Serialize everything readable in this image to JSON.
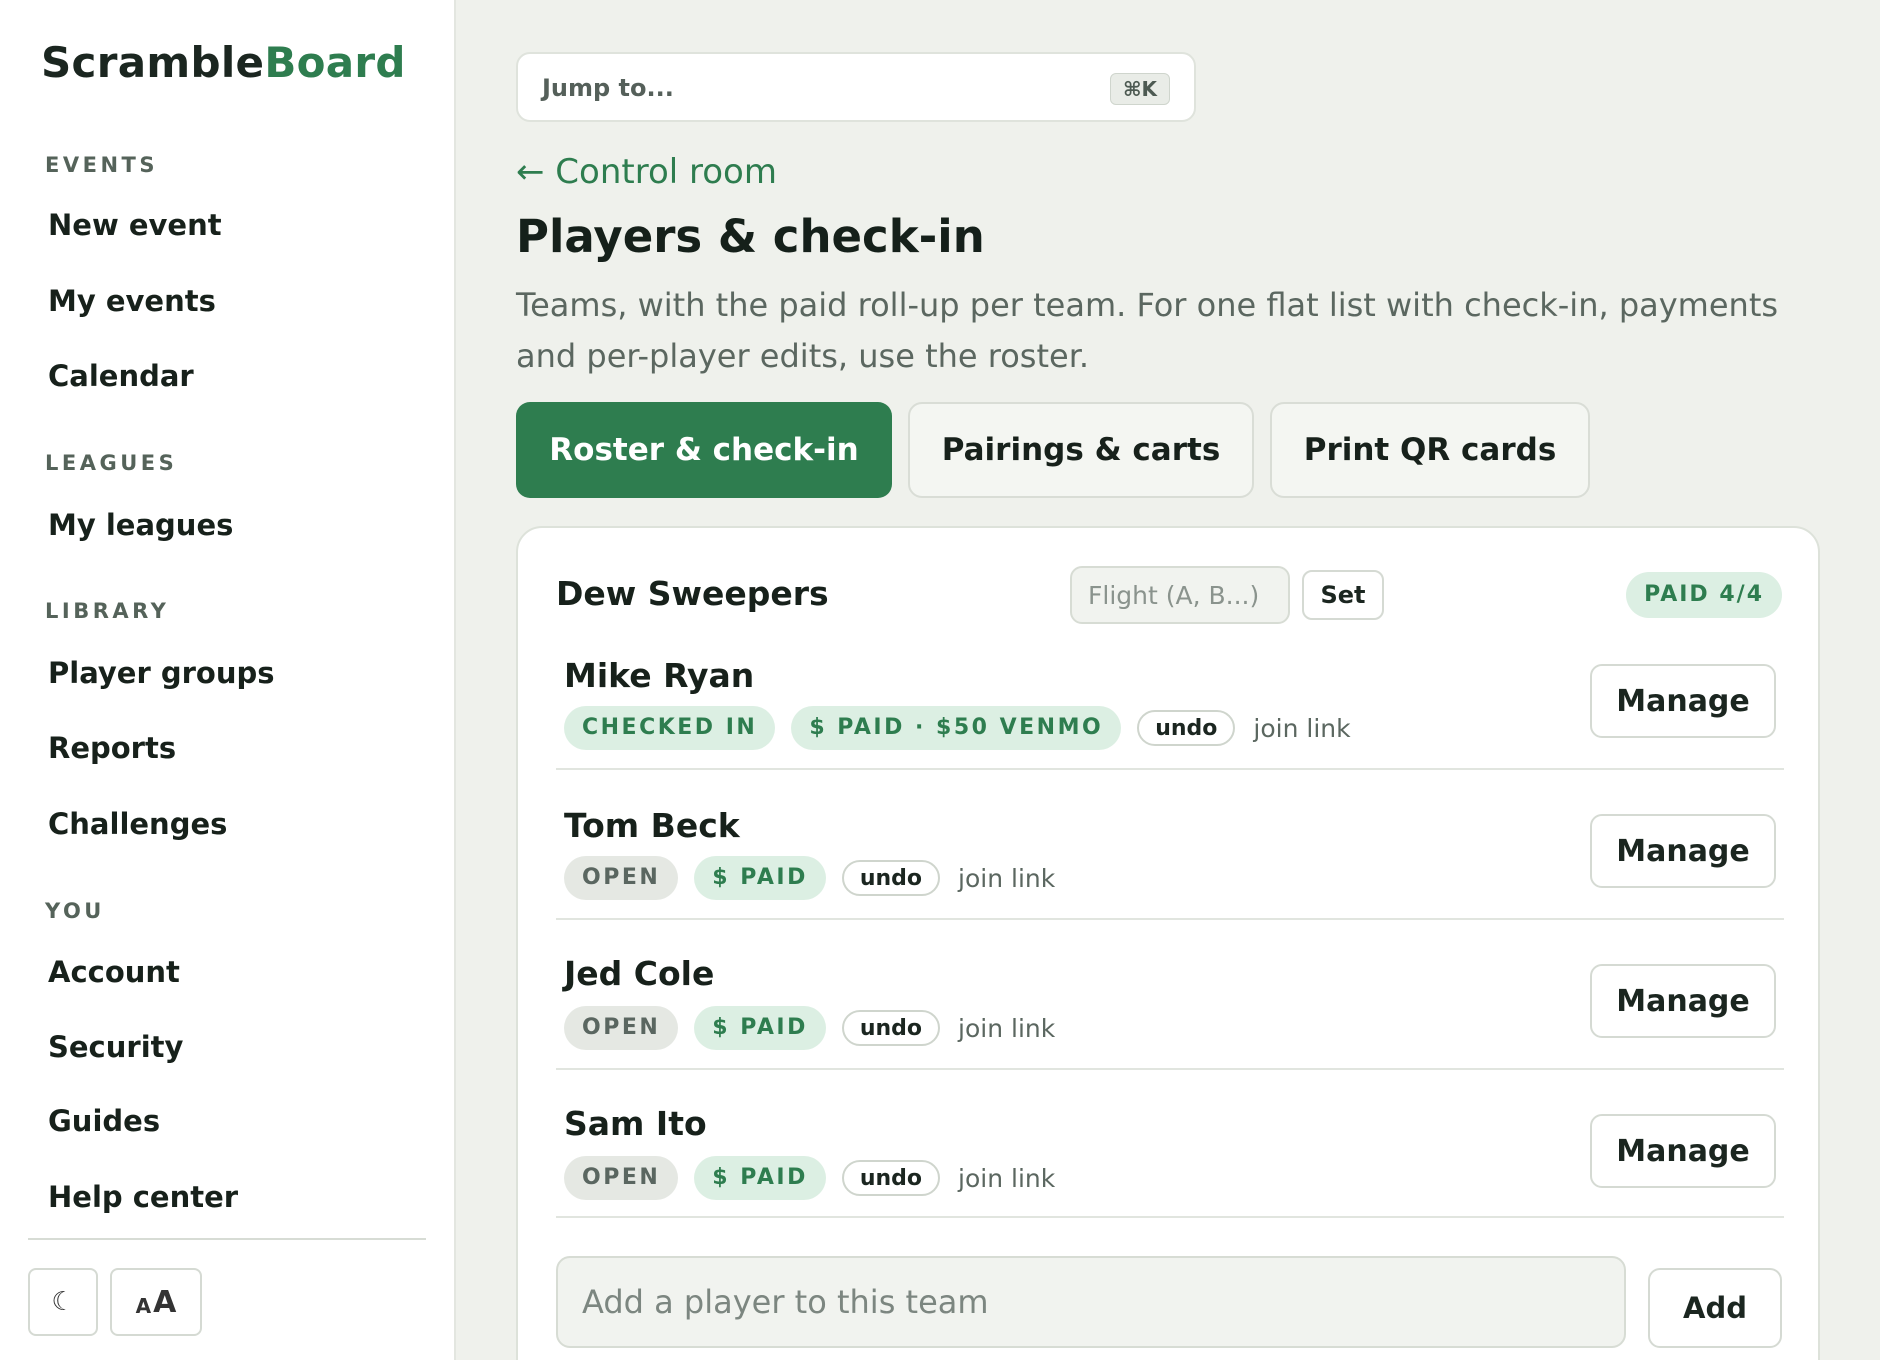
{
  "brand": {
    "part1": "Scramble",
    "part2": "Board"
  },
  "sidebar": {
    "sections": [
      {
        "label": "EVENTS",
        "items": [
          "New event",
          "My events",
          "Calendar"
        ]
      },
      {
        "label": "LEAGUES",
        "items": [
          "My leagues"
        ]
      },
      {
        "label": "LIBRARY",
        "items": [
          "Player groups",
          "Reports",
          "Challenges"
        ]
      },
      {
        "label": "YOU",
        "items": [
          "Account",
          "Security",
          "Guides",
          "Help center"
        ]
      }
    ],
    "theme_toggle_glyph": "☾",
    "font_size_small": "A",
    "font_size_large": "A"
  },
  "jump": {
    "placeholder": "Jump to...",
    "shortcut": "⌘K"
  },
  "breadcrumb": {
    "back": "← Control room"
  },
  "page": {
    "title": "Players & check-in",
    "intro": "Teams, with the paid roll-up per team. For one flat list with check-in, payments and per-player edits, use the roster."
  },
  "tabs": [
    {
      "label": "Roster & check-in",
      "active": true
    },
    {
      "label": "Pairings & carts",
      "active": false
    },
    {
      "label": "Print QR cards",
      "active": false
    }
  ],
  "team": {
    "name": "Dew Sweepers",
    "flight_placeholder": "Flight (A, B...)",
    "set_label": "Set",
    "paid_summary": "PAID 4/4",
    "add_placeholder": "Add a player to this team",
    "add_label": "Add",
    "players": [
      {
        "name": "Mike Ryan",
        "status": "CHECKED IN",
        "status_style": "green",
        "payment": "$ PAID · $50 VENMO",
        "undo": "undo",
        "join": "join link",
        "manage": "Manage"
      },
      {
        "name": "Tom Beck",
        "status": "OPEN",
        "status_style": "grey",
        "payment": "$ PAID",
        "undo": "undo",
        "join": "join link",
        "manage": "Manage"
      },
      {
        "name": "Jed Cole",
        "status": "OPEN",
        "status_style": "grey",
        "payment": "$ PAID",
        "undo": "undo",
        "join": "join link",
        "manage": "Manage"
      },
      {
        "name": "Sam Ito",
        "status": "OPEN",
        "status_style": "grey",
        "payment": "$ PAID",
        "undo": "undo",
        "join": "join link",
        "manage": "Manage"
      }
    ]
  },
  "colors": {
    "accent": "#2e7d4f",
    "background": "#eff1ec",
    "badge_green_bg": "#dcefe3",
    "badge_grey_bg": "#e5e8e3"
  }
}
